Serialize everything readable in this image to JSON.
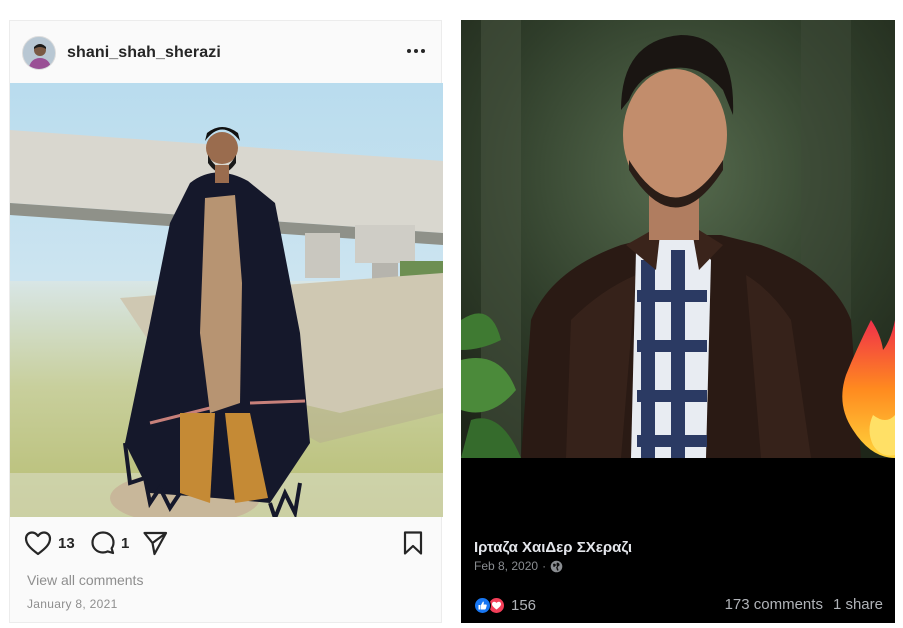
{
  "instagram_post": {
    "username": "shani_shah_sherazi",
    "likes_count": "13",
    "comments_count": "1",
    "view_comments_label": "View all comments",
    "date": "January 8, 2021",
    "icons": {
      "more": "more-options-icon",
      "like": "heart-icon",
      "comment": "comment-icon",
      "share": "send-icon",
      "save": "bookmark-icon"
    },
    "colors": {
      "text": "#262626",
      "muted": "#8e8e8e",
      "card_bg": "#fafafa"
    }
  },
  "facebook_post": {
    "author": "Ιρταζα ΧαιΔερ ΣΧεραζι",
    "date": "Feb 8, 2020",
    "separator": "·",
    "privacy_icon": "globe-icon",
    "reactions_count": "156",
    "comments_label": "173 comments",
    "shares_label": "1 share",
    "reaction_icons": [
      "like-reaction-icon",
      "love-reaction-icon"
    ],
    "overlay_emoji": "fire-icon",
    "colors": {
      "bg": "#000000",
      "author": "#e4e6eb",
      "muted": "#b0b3b8",
      "like_blue": "#1877f2",
      "love_red": "#f33e58"
    }
  }
}
